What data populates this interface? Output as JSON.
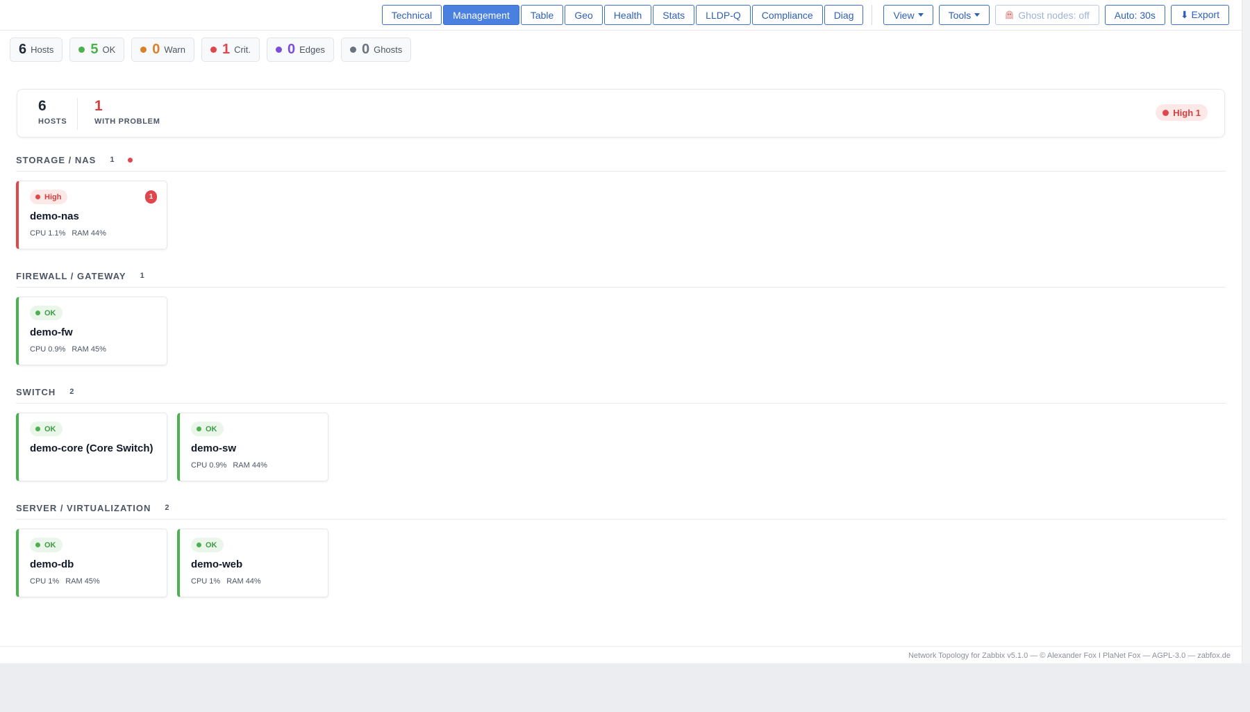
{
  "toolbar": {
    "views": [
      {
        "label": "Technical"
      },
      {
        "label": "Management"
      },
      {
        "label": "Table"
      },
      {
        "label": "Geo"
      },
      {
        "label": "Health"
      },
      {
        "label": "Stats"
      },
      {
        "label": "LLDP-Q"
      },
      {
        "label": "Compliance"
      },
      {
        "label": "Diag"
      }
    ],
    "active_view": "Management",
    "view_menu": "View",
    "tools_menu": "Tools",
    "ghost_nodes": "Ghost nodes: off",
    "auto_refresh": "Auto: 30s",
    "export": "⬇ Export"
  },
  "stats": {
    "hosts": {
      "value": "6",
      "label": "Hosts"
    },
    "ok": {
      "value": "5",
      "label": "OK",
      "color": "#4caf50"
    },
    "warn": {
      "value": "0",
      "label": "Warn",
      "color": "#d9822b"
    },
    "crit": {
      "value": "1",
      "label": "Crit.",
      "color": "#e0474c"
    },
    "edges": {
      "value": "0",
      "label": "Edges",
      "color": "#7c4ddb"
    },
    "ghosts": {
      "value": "0",
      "label": "Ghosts",
      "color": "#6b7280"
    }
  },
  "summary": {
    "hosts_value": "6",
    "hosts_label": "HOSTS",
    "problem_value": "1",
    "problem_label": "WITH PROBLEM",
    "severity_pill": "High 1"
  },
  "groups": [
    {
      "title": "STORAGE / NAS",
      "count": "1",
      "hosts": [
        {
          "status": "High",
          "name": "demo-nas",
          "cpu": "CPU 1.1%",
          "ram": "RAM 44%",
          "problems": "1"
        }
      ]
    },
    {
      "title": "FIREWALL / GATEWAY",
      "count": "1",
      "hosts": [
        {
          "status": "OK",
          "name": "demo-fw",
          "cpu": "CPU 0.9%",
          "ram": "RAM 45%"
        }
      ]
    },
    {
      "title": "SWITCH",
      "count": "2",
      "hosts": [
        {
          "status": "OK",
          "name": "demo-core (Core Switch)"
        },
        {
          "status": "OK",
          "name": "demo-sw",
          "cpu": "CPU 0.9%",
          "ram": "RAM 44%"
        }
      ]
    },
    {
      "title": "SERVER / VIRTUALIZATION",
      "count": "2",
      "hosts": [
        {
          "status": "OK",
          "name": "demo-db",
          "cpu": "CPU 1%",
          "ram": "RAM 45%"
        },
        {
          "status": "OK",
          "name": "demo-web",
          "cpu": "CPU 1%",
          "ram": "RAM 44%"
        }
      ]
    }
  ],
  "colors": {
    "ok": "#4caf50",
    "critical": "#e0474c",
    "accent": "#4a80e0"
  },
  "footer": "Network Topology for Zabbix v5.1.0 — © Alexander Fox I PlaNet Fox — AGPL-3.0 — zabfox.de"
}
